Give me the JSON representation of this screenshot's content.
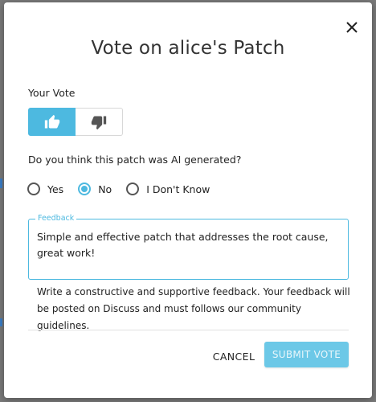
{
  "dialog": {
    "title": "Vote on alice's Patch",
    "your_vote_label": "Your Vote",
    "vote_options": {
      "upvote": "thumbs-up-icon",
      "downvote": "thumbs-down-icon",
      "selected": "upvote"
    },
    "question": "Do you think this patch was AI generated?",
    "ai_options": [
      {
        "label": "Yes",
        "checked": false
      },
      {
        "label": "No",
        "checked": true
      },
      {
        "label": "I Don't Know",
        "checked": false
      }
    ],
    "feedback": {
      "legend": "Feedback",
      "value": "Simple and effective patch that addresses the root cause, great work!"
    },
    "helper_text": "Write a constructive and supportive feedback. Your feedback will be posted on Discuss and must follows our community guidelines.",
    "cancel_label": "CANCEL",
    "submit_label": "SUBMIT VOTE"
  },
  "colors": {
    "accent": "#4db9e0",
    "submit_bg": "#6cc8e7",
    "backdrop": "#7a7a7a"
  }
}
